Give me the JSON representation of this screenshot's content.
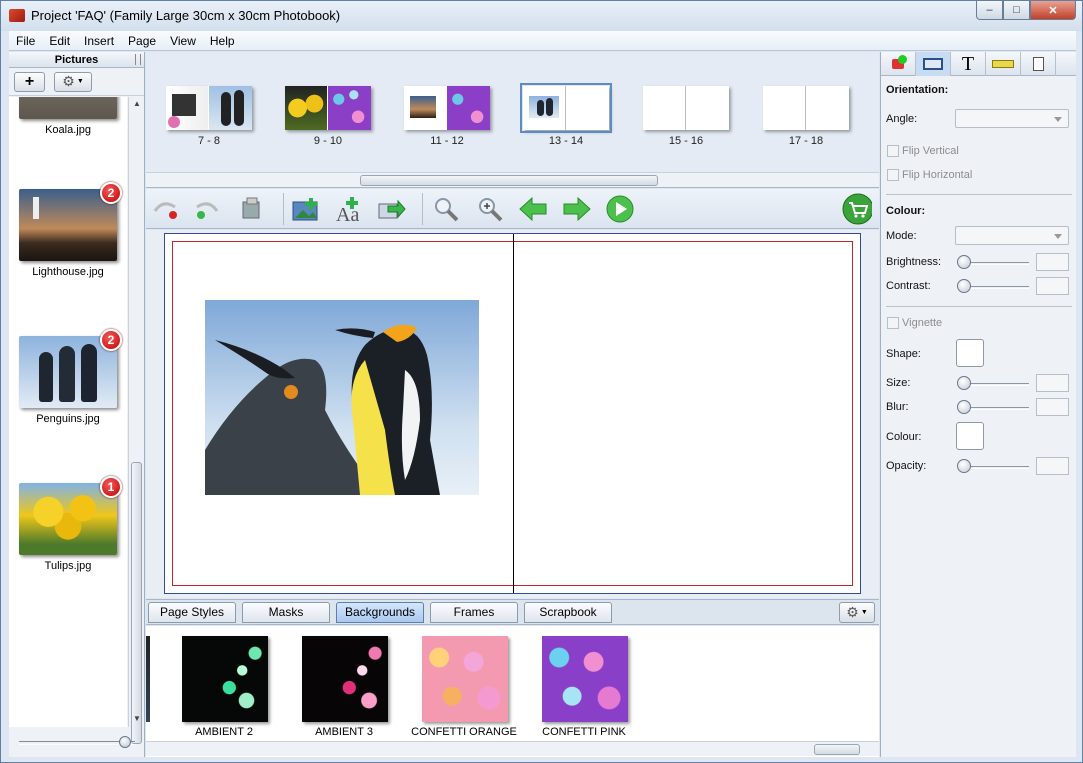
{
  "window": {
    "title": "Project 'FAQ' (Family Large 30cm x 30cm Photobook)"
  },
  "menu": [
    "File",
    "Edit",
    "Insert",
    "Page",
    "View",
    "Help"
  ],
  "pictures_panel": {
    "title": "Pictures",
    "items": [
      {
        "name": "Koala.jpg",
        "badge": ""
      },
      {
        "name": "Lighthouse.jpg",
        "badge": "2"
      },
      {
        "name": "Penguins.jpg",
        "badge": "2"
      },
      {
        "name": "Tulips.jpg",
        "badge": "1"
      }
    ]
  },
  "spreads": [
    {
      "label": "7 - 8"
    },
    {
      "label": "9 - 10"
    },
    {
      "label": "11 - 12"
    },
    {
      "label": "13 - 14",
      "selected": true
    },
    {
      "label": "15 - 16"
    },
    {
      "label": "17 - 18"
    }
  ],
  "tabs": [
    "Page Styles",
    "Masks",
    "Backgrounds",
    "Frames",
    "Scrapbook"
  ],
  "active_tab": "Backgrounds",
  "backgrounds": [
    "AMBIENT 2",
    "AMBIENT 3",
    "CONFETTI ORANGE",
    "CONFETTI PINK"
  ],
  "properties": {
    "orientation": "Orientation:",
    "angle": "Angle:",
    "flip_vertical": "Flip Vertical",
    "flip_horizontal": "Flip Horizontal",
    "colour_header": "Colour:",
    "mode": "Mode:",
    "brightness": "Brightness:",
    "contrast": "Contrast:",
    "vignette": "Vignette",
    "shape": "Shape:",
    "size": "Size:",
    "blur": "Blur:",
    "colour": "Colour:",
    "opacity": "Opacity:"
  },
  "colors": {
    "accent": "#5b8cc4",
    "badge": "#d00000",
    "page_border": "#c0262d"
  }
}
